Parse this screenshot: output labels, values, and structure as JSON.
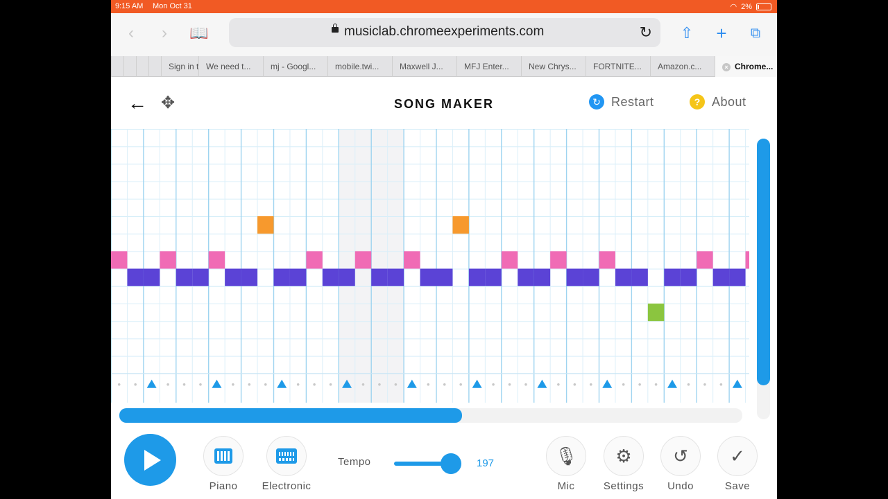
{
  "status": {
    "time": "9:15 AM",
    "date": "Mon Oct 31",
    "battery": "2%"
  },
  "browser": {
    "url": "musiclab.chromeexperiments.com",
    "tabs": [
      "Sign in t",
      "We need t...",
      "mj - Googl...",
      "mobile.twi...",
      "Maxwell J...",
      "MFJ Enter...",
      "New Chrys...",
      "FORTNITE...",
      "Amazon.c...",
      "Chrome..."
    ]
  },
  "app": {
    "title": "SONG MAKER",
    "restart_label": "Restart",
    "about_label": "About"
  },
  "grid": {
    "columns": 40,
    "rows": 14,
    "beats_per_bar": 2,
    "shaded_bars": [
      7,
      8
    ],
    "colors": {
      "orange": "#f7992d",
      "pink": "#f06bb5",
      "indigo": "#5b43d6",
      "green": "#8bc53f",
      "accent": "#1e9ae8"
    },
    "notes": [
      {
        "row": 5,
        "cols": [
          9,
          21
        ],
        "color": "orange"
      },
      {
        "row": 7,
        "cols": [
          0,
          3,
          6,
          12,
          15,
          18,
          24,
          27,
          30,
          36,
          39
        ],
        "color": "pink"
      },
      {
        "row": 8,
        "cols": [
          1,
          2,
          4,
          5,
          7,
          8,
          10,
          11,
          13,
          14,
          16,
          17,
          19,
          20,
          22,
          23,
          25,
          26,
          28,
          29,
          31,
          32,
          34,
          35,
          37,
          38
        ],
        "color": "indigo"
      },
      {
        "row": 10,
        "cols": [
          33
        ],
        "color": "green"
      }
    ],
    "percussion_triangles": [
      2,
      6,
      10,
      14,
      18,
      22,
      26,
      30,
      34,
      38
    ],
    "percussion_circles": [
      0,
      1,
      4,
      5,
      8,
      9,
      12,
      13,
      16,
      17,
      20,
      21,
      24,
      25,
      28,
      29,
      32,
      33,
      36,
      37
    ]
  },
  "scroll": {
    "horizontal_fraction": 0.55,
    "vertical_fraction": 0.88
  },
  "controls": {
    "instrument1_label": "Piano",
    "instrument2_label": "Electronic",
    "tempo_label": "Tempo",
    "tempo_value": "197",
    "mic_label": "Mic",
    "settings_label": "Settings",
    "undo_label": "Undo",
    "save_label": "Save"
  }
}
